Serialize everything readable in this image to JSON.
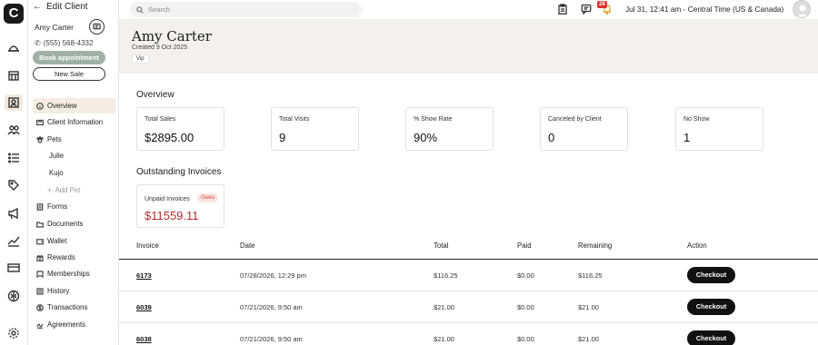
{
  "sidebar": {
    "back_label": "Edit Client",
    "client_name": "Amy Carter",
    "phone": "(555) 568-4332",
    "book_label": "Book appointment",
    "new_sale_label": "New Sale",
    "nav": {
      "overview": "Overview",
      "client_information": "Client Information",
      "pets": "Pets",
      "pet_1": "Julie",
      "pet_2": "Kujo",
      "add_pet": "Add Pet",
      "forms": "Forms",
      "documents": "Documents",
      "wallet": "Wallet",
      "rewards": "Rewards",
      "memberships": "Memberships",
      "history": "History",
      "transactions": "Transactions",
      "agreements": "Agreements"
    }
  },
  "topbar": {
    "search_placeholder": "Search",
    "notification_count": "28",
    "datetime": "Jul 31, 12:41 am - Central Time (US & Canada)"
  },
  "header": {
    "name": "Amy Carter",
    "created": "Created 9 Oct 2025",
    "tag": "Vip"
  },
  "overview": {
    "title": "Overview",
    "cards": [
      {
        "label": "Total Sales",
        "value": "$2895.00"
      },
      {
        "label": "Total Visits",
        "value": "9"
      },
      {
        "label": "% Show Rate",
        "value": "90%"
      },
      {
        "label": "Canceled by Client",
        "value": "0"
      },
      {
        "label": "No Show",
        "value": "1"
      }
    ]
  },
  "outstanding": {
    "title": "Outstanding Invoices",
    "label": "Unpaid Invoices",
    "badge": "Owes",
    "value": "$11559.11"
  },
  "table": {
    "headers": {
      "invoice": "Invoice",
      "date": "Date",
      "total": "Total",
      "paid": "Paid",
      "remaining": "Remaining",
      "action": "Action"
    },
    "rows": [
      {
        "invoice": "6173",
        "date": "07/28/2026, 12:29 pm",
        "total": "$116.25",
        "paid": "$0.00",
        "remaining": "$116.25",
        "action": "Checkout"
      },
      {
        "invoice": "6039",
        "date": "07/21/2026, 9:50 am",
        "total": "$21.00",
        "paid": "$0.00",
        "remaining": "$21.00",
        "action": "Checkout"
      },
      {
        "invoice": "6038",
        "date": "07/21/2026, 9:50 am",
        "total": "$21.00",
        "paid": "$0.00",
        "remaining": "$21.00",
        "action": "Checkout"
      }
    ]
  }
}
